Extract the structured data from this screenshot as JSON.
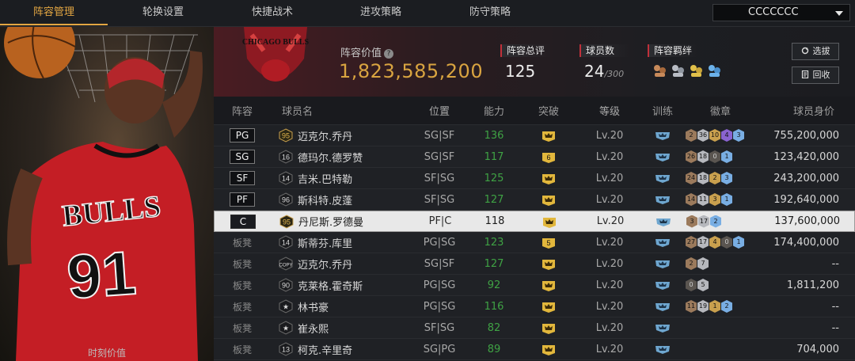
{
  "nav": {
    "tabs": [
      {
        "label": "阵容管理",
        "active": true
      },
      {
        "label": "轮换设置",
        "active": false
      },
      {
        "label": "快捷战术",
        "active": false
      },
      {
        "label": "进攻策略",
        "active": false
      },
      {
        "label": "防守策略",
        "active": false
      }
    ],
    "account_select": "CCCCCCC"
  },
  "player_panel": {
    "jersey_text": "BULLS",
    "jersey_number": "91",
    "caption": "时刻价值"
  },
  "team": {
    "logo_text": "CHICAGO BULLS",
    "value_label": "阵容价值",
    "value": "1,823,585,200",
    "overall_label": "阵容总评",
    "overall": "125",
    "count_label": "球员数",
    "count": "24",
    "count_max": "/300",
    "bond_label": "阵容羁绊",
    "bond_icons": [
      "bond-icon-orange",
      "bond-icon-silver",
      "bond-icon-gold",
      "bond-icon-blue"
    ],
    "btn_pick": "选拔",
    "btn_recycle": "回收"
  },
  "table": {
    "headers": {
      "pos": "阵容",
      "name": "球员名",
      "role": "位置",
      "ability": "能力",
      "break": "突破",
      "level": "等级",
      "train": "训练",
      "badge": "徽章",
      "worth": "球员身价"
    },
    "rows": [
      {
        "pos": "PG",
        "num": "95",
        "name": "迈克尔.乔丹",
        "role": "SG|SF",
        "ability": "136",
        "break": "",
        "level": "Lv.20",
        "badges": [
          {
            "t": "2",
            "c": "bronze"
          },
          {
            "t": "36",
            "c": "silver"
          },
          {
            "t": "10",
            "c": "gold"
          },
          {
            "t": "4",
            "c": "purple"
          },
          {
            "t": "3",
            "c": "blue"
          }
        ],
        "worth": "755,200,000"
      },
      {
        "pos": "SG",
        "num": "16",
        "name": "德玛尔.德罗赞",
        "role": "SG|SF",
        "ability": "117",
        "break": "6",
        "level": "Lv.20",
        "badges": [
          {
            "t": "26",
            "c": "bronze"
          },
          {
            "t": "18",
            "c": "silver"
          },
          {
            "t": "0",
            "c": "dark"
          },
          {
            "t": "1",
            "c": "blue"
          }
        ],
        "worth": "123,420,000"
      },
      {
        "pos": "SF",
        "num": "14",
        "name": "吉米.巴特勒",
        "role": "SF|SG",
        "ability": "125",
        "break": "",
        "level": "Lv.20",
        "badges": [
          {
            "t": "24",
            "c": "bronze"
          },
          {
            "t": "18",
            "c": "silver"
          },
          {
            "t": "2",
            "c": "gold"
          },
          {
            "t": "3",
            "c": "blue"
          }
        ],
        "worth": "243,200,000"
      },
      {
        "pos": "PF",
        "num": "96",
        "name": "斯科特.皮蓬",
        "role": "SF|SG",
        "ability": "127",
        "break": "",
        "level": "Lv.20",
        "badges": [
          {
            "t": "14",
            "c": "bronze"
          },
          {
            "t": "11",
            "c": "silver"
          },
          {
            "t": "3",
            "c": "gold"
          },
          {
            "t": "1",
            "c": "blue"
          }
        ],
        "worth": "192,640,000"
      },
      {
        "pos": "C",
        "num": "95",
        "name": "丹尼斯.罗德曼",
        "role": "PF|C",
        "ability": "118",
        "break": "",
        "level": "Lv.20",
        "badges": [
          {
            "t": "3",
            "c": "bronze"
          },
          {
            "t": "17",
            "c": "silver"
          },
          {
            "t": "2",
            "c": "blue"
          }
        ],
        "worth": "137,600,000",
        "selected": true
      },
      {
        "pos": "板凳",
        "num": "14",
        "name": "斯蒂芬.库里",
        "role": "PG|SG",
        "ability": "123",
        "break": "5",
        "level": "Lv.20",
        "badges": [
          {
            "t": "27",
            "c": "bronze"
          },
          {
            "t": "17",
            "c": "silver"
          },
          {
            "t": "4",
            "c": "gold"
          },
          {
            "t": "0",
            "c": "dark"
          },
          {
            "t": "1",
            "c": "blue"
          }
        ],
        "worth": "174,400,000"
      },
      {
        "pos": "板凳",
        "num": "COPY",
        "name": "迈克尔.乔丹",
        "role": "SG|SF",
        "ability": "127",
        "break": "",
        "level": "Lv.20",
        "badges": [
          {
            "t": "2",
            "c": "bronze"
          },
          {
            "t": "7",
            "c": "silver"
          }
        ],
        "worth": "--"
      },
      {
        "pos": "板凳",
        "num": "90",
        "name": "克莱格.霍奇斯",
        "role": "PG|SG",
        "ability": "92",
        "break": "",
        "level": "Lv.20",
        "badges": [
          {
            "t": "0",
            "c": "dark"
          },
          {
            "t": "5",
            "c": "silver"
          }
        ],
        "worth": "1,811,200"
      },
      {
        "pos": "板凳",
        "num": "★",
        "name": "林书豪",
        "role": "PG|SG",
        "ability": "116",
        "break": "",
        "level": "Lv.20",
        "badges": [
          {
            "t": "11",
            "c": "bronze"
          },
          {
            "t": "19",
            "c": "silver"
          },
          {
            "t": "1",
            "c": "gold"
          },
          {
            "t": "2",
            "c": "blue"
          }
        ],
        "worth": "--"
      },
      {
        "pos": "板凳",
        "num": "★",
        "name": "崔永熙",
        "role": "SF|SG",
        "ability": "82",
        "break": "",
        "level": "Lv.20",
        "badges": [],
        "worth": "--"
      },
      {
        "pos": "板凳",
        "num": "13",
        "name": "柯克.辛里奇",
        "role": "SG|PG",
        "ability": "89",
        "break": "",
        "level": "Lv.20",
        "badges": [],
        "worth": "704,000"
      }
    ]
  }
}
